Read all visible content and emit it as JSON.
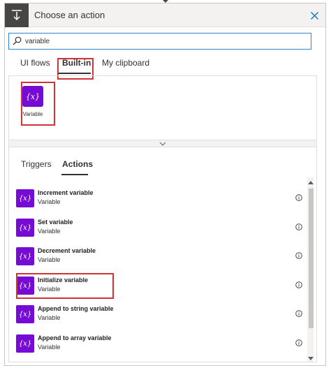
{
  "header": {
    "title": "Choose an action"
  },
  "search": {
    "value": "variable"
  },
  "source_tabs": [
    {
      "label": "UI flows",
      "selected": false
    },
    {
      "label": "Built-in",
      "selected": true
    },
    {
      "label": "My clipboard",
      "selected": false
    }
  ],
  "builtin_tile": {
    "icon_text": "{x}",
    "label": "Variable"
  },
  "action_tabs": [
    {
      "label": "Triggers",
      "selected": false
    },
    {
      "label": "Actions",
      "selected": true
    }
  ],
  "actions": [
    {
      "name": "Increment variable",
      "connector": "Variable",
      "icon_text": "{x}"
    },
    {
      "name": "Set variable",
      "connector": "Variable",
      "icon_text": "{x}"
    },
    {
      "name": "Decrement variable",
      "connector": "Variable",
      "icon_text": "{x}"
    },
    {
      "name": "Initialize variable",
      "connector": "Variable",
      "icon_text": "{x}"
    },
    {
      "name": "Append to string variable",
      "connector": "Variable",
      "icon_text": "{x}"
    },
    {
      "name": "Append to array variable",
      "connector": "Variable",
      "icon_text": "{x}"
    }
  ],
  "colors": {
    "accent": "#770bd6",
    "highlight": "#d13438",
    "focus": "#2b88d8"
  },
  "icons": {
    "header": "download-tray-icon",
    "close": "close-icon",
    "search": "search-icon",
    "info": "info-icon"
  }
}
